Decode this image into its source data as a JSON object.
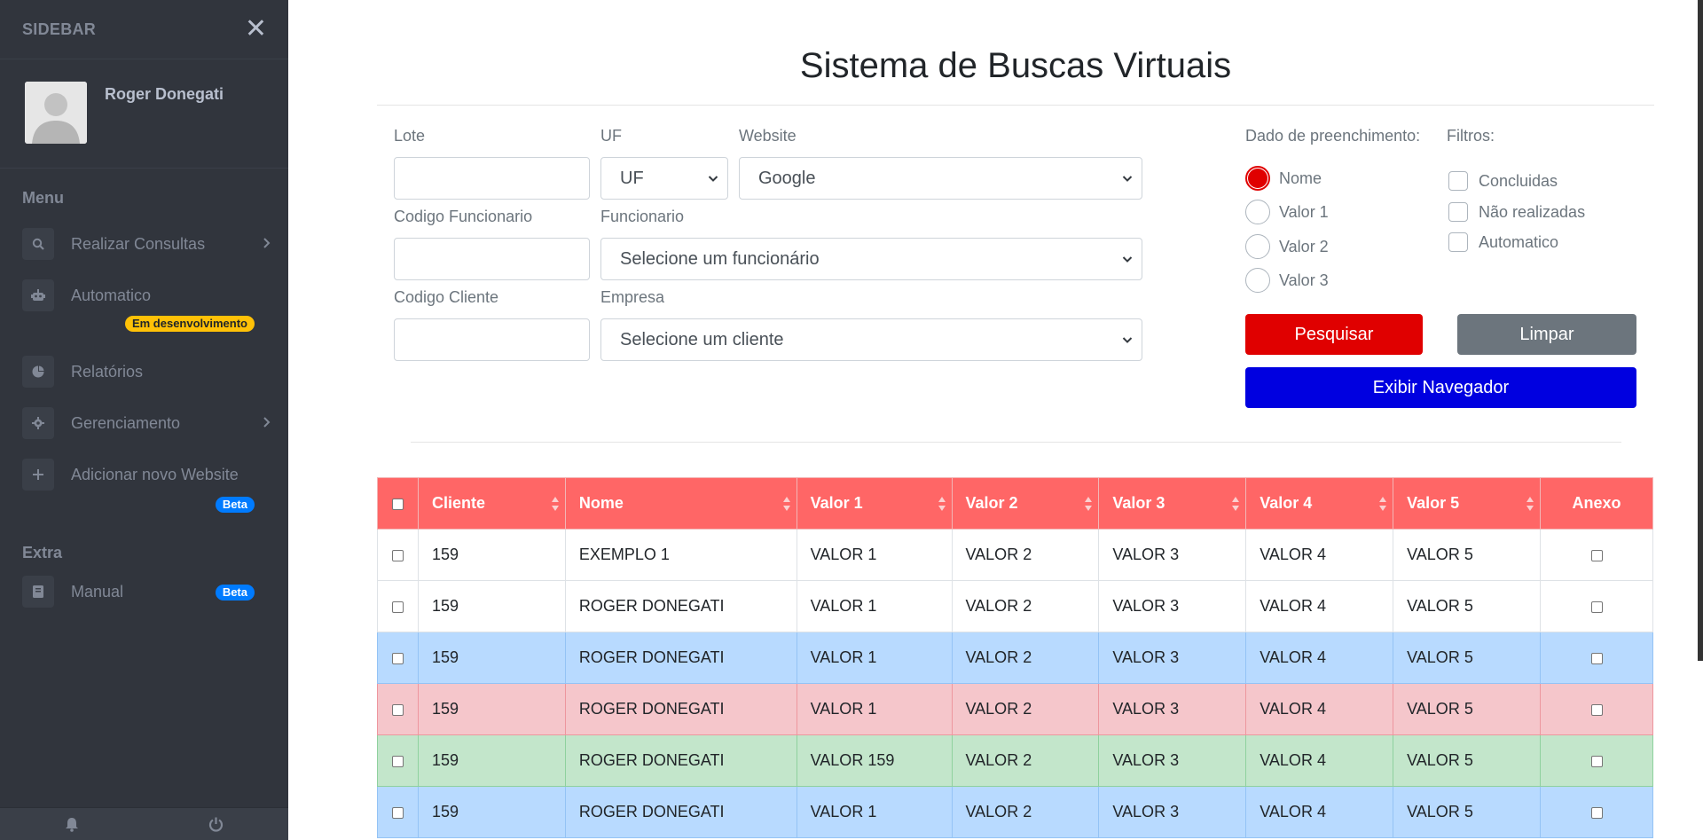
{
  "sidebar": {
    "brand": "SIDEBAR",
    "user_name": "Roger Donegati",
    "section_menu": "Menu",
    "section_extra": "Extra",
    "items": [
      {
        "label": "Realizar Consultas"
      },
      {
        "label": "Automatico"
      },
      {
        "label": "Relatórios"
      },
      {
        "label": "Gerenciamento"
      },
      {
        "label": "Adicionar novo Website"
      },
      {
        "label": "Manual"
      }
    ],
    "badges": {
      "dev": "Em desenvolvimento",
      "beta_add": "Beta",
      "beta_manual": "Beta"
    }
  },
  "main": {
    "title": "Sistema de Buscas Virtuais",
    "form": {
      "lote_label": "Lote",
      "uf_label": "UF",
      "uf_value": "UF",
      "website_label": "Website",
      "website_value": "Google",
      "codigo_funcionario_label": "Codigo Funcionario",
      "funcionario_label": "Funcionario",
      "funcionario_value": "Selecione um funcionário",
      "codigo_cliente_label": "Codigo Cliente",
      "empresa_label": "Empresa",
      "empresa_value": "Selecione um cliente"
    },
    "fill_data": {
      "label": "Dado de preenchimento:",
      "options": [
        "Nome",
        "Valor 1",
        "Valor 2",
        "Valor 3"
      ],
      "selected": "Nome"
    },
    "filters": {
      "label": "Filtros:",
      "options": [
        "Concluidas",
        "Não realizadas",
        "Automatico"
      ]
    },
    "buttons": {
      "search": "Pesquisar",
      "clear": "Limpar",
      "show_browser": "Exibir Navegador"
    },
    "colors": {
      "primary_red": "#e00000",
      "header_red": "#ff6666",
      "blue_button": "#0000e0",
      "gray_button": "#6c757d"
    }
  },
  "table": {
    "columns": [
      "Cliente",
      "Nome",
      "Valor 1",
      "Valor 2",
      "Valor 3",
      "Valor 4",
      "Valor 5",
      "Anexo"
    ],
    "rows": [
      {
        "variant": "white",
        "cells": [
          "159",
          "EXEMPLO 1",
          "VALOR 1",
          "VALOR 2",
          "VALOR 3",
          "VALOR 4",
          "VALOR 5"
        ]
      },
      {
        "variant": "white",
        "cells": [
          "159",
          "ROGER DONEGATI",
          "VALOR 1",
          "VALOR 2",
          "VALOR 3",
          "VALOR 4",
          "VALOR 5"
        ]
      },
      {
        "variant": "blue",
        "cells": [
          "159",
          "ROGER DONEGATI",
          "VALOR 1",
          "VALOR 2",
          "VALOR 3",
          "VALOR 4",
          "VALOR 5"
        ]
      },
      {
        "variant": "red",
        "cells": [
          "159",
          "ROGER DONEGATI",
          "VALOR 1",
          "VALOR 2",
          "VALOR 3",
          "VALOR 4",
          "VALOR 5"
        ]
      },
      {
        "variant": "green",
        "cells": [
          "159",
          "ROGER DONEGATI",
          "VALOR 159",
          "VALOR 2",
          "VALOR 3",
          "VALOR 4",
          "VALOR 5"
        ]
      },
      {
        "variant": "blue",
        "cells": [
          "159",
          "ROGER DONEGATI",
          "VALOR 1",
          "VALOR 2",
          "VALOR 3",
          "VALOR 4",
          "VALOR 5"
        ]
      }
    ]
  }
}
